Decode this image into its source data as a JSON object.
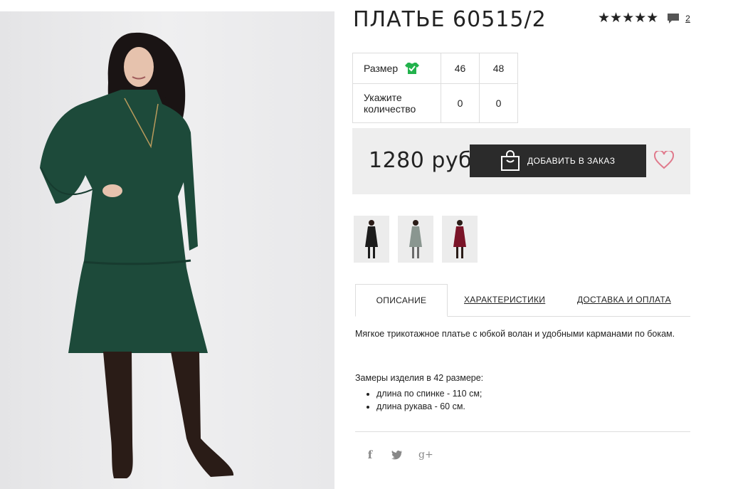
{
  "product": {
    "title": "ПЛАТЬЕ 60515/2",
    "rating_stars": "★★★★★",
    "reviews_count": "2",
    "price": "1280 руб",
    "add_button_label": "ДОБАВИТЬ В ЗАКАЗ"
  },
  "size_table": {
    "size_label": "Размер",
    "qty_label": "Укажите количество",
    "sizes": [
      "46",
      "48"
    ],
    "quantities": [
      "0",
      "0"
    ]
  },
  "thumbnails": [
    {
      "name": "thumb-black-dress",
      "color": "#1c1c1c"
    },
    {
      "name": "thumb-grey-dress",
      "color": "#8a9690"
    },
    {
      "name": "thumb-burgundy-dress",
      "color": "#7a1428"
    }
  ],
  "tabs": {
    "description": "ОПИСАНИЕ",
    "characteristics": "ХАРАКТЕРИСТИКИ",
    "delivery": "ДОСТАВКА И ОПЛАТА"
  },
  "description": {
    "text": "Мягкое трикотажное платье с юбкой волан и удобными карманами по бокам.",
    "measures_title": "Замеры изделия в 42 размере:",
    "measures": [
      "длина по спинке - 110 см;",
      "длина рукава - 60 см."
    ]
  },
  "social": {
    "facebook": "f",
    "twitter": "t",
    "googleplus": "g+"
  },
  "colors": {
    "dress_green": "#1d4a3a",
    "button_dark": "#2b2b2b",
    "heart_pink": "#e07a8c",
    "size_icon_green": "#22b24c"
  }
}
